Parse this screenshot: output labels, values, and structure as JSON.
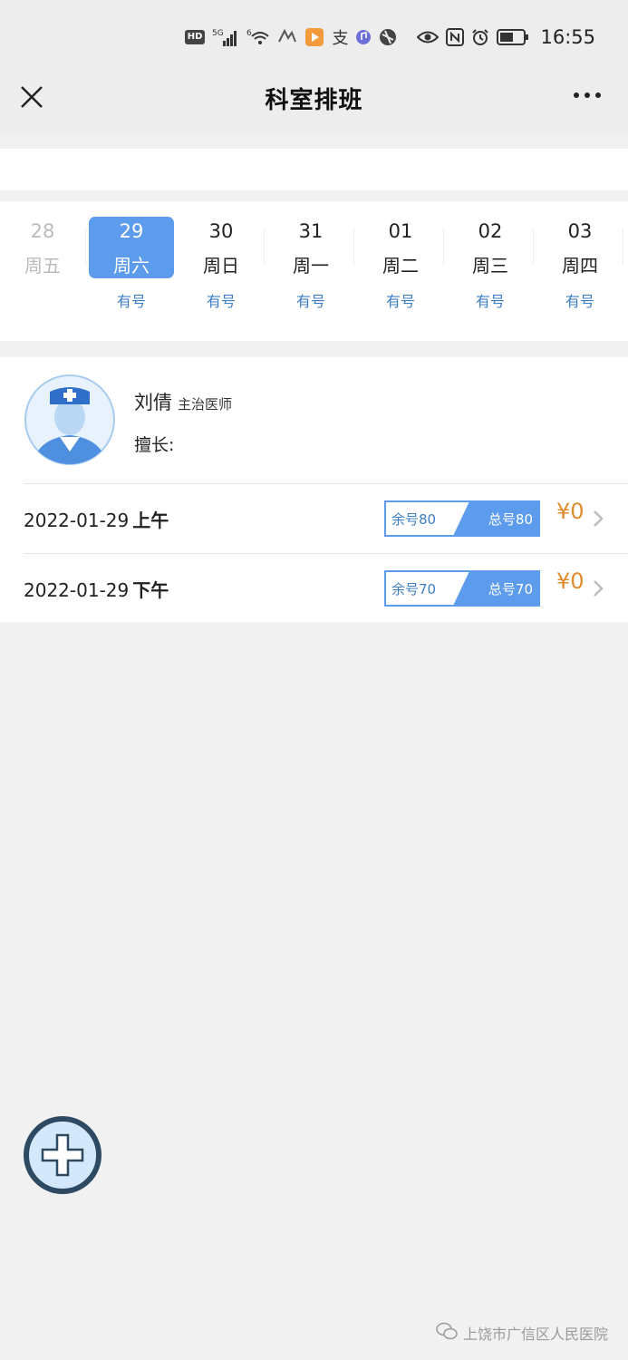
{
  "status_bar": {
    "hd": "HD",
    "net1": "5G",
    "net2": "6",
    "time": "16:55"
  },
  "nav": {
    "title": "科室排班"
  },
  "dates": [
    {
      "num": "28",
      "weekday": "周五",
      "availability": "",
      "state": "past"
    },
    {
      "num": "29",
      "weekday": "周六",
      "availability": "有号",
      "state": "active"
    },
    {
      "num": "30",
      "weekday": "周日",
      "availability": "有号",
      "state": "normal"
    },
    {
      "num": "31",
      "weekday": "周一",
      "availability": "有号",
      "state": "normal"
    },
    {
      "num": "01",
      "weekday": "周二",
      "availability": "有号",
      "state": "normal"
    },
    {
      "num": "02",
      "weekday": "周三",
      "availability": "有号",
      "state": "normal"
    },
    {
      "num": "03",
      "weekday": "周四",
      "availability": "有号",
      "state": "normal"
    }
  ],
  "doctor": {
    "name": "刘倩",
    "title": "主治医师",
    "specialty_label": "擅长:"
  },
  "slots": [
    {
      "date": "2022-01-29",
      "period": "上午",
      "remaining": "余号80",
      "total": "总号80",
      "price": "¥0"
    },
    {
      "date": "2022-01-29",
      "period": "下午",
      "remaining": "余号70",
      "total": "总号70",
      "price": "¥0"
    }
  ],
  "watermark": {
    "text": "上饶市广信区人民医院"
  },
  "colors": {
    "accent": "#5d9cec",
    "availability": "#3d7ec4",
    "price": "#e08b2e",
    "background": "#f1f1f2"
  }
}
